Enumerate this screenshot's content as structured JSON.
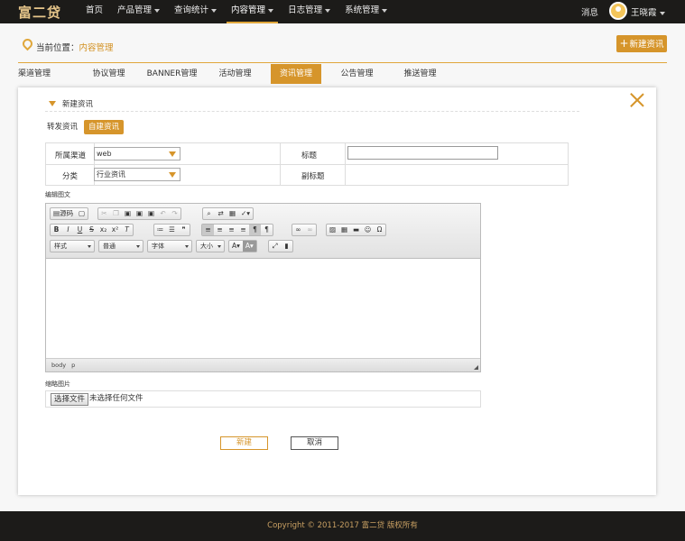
{
  "colors": {
    "accent": "#d6952b",
    "topbar": "#1c1b19"
  },
  "header": {
    "logo": "富二贷",
    "nav": [
      {
        "label": "首页",
        "dropdown": false
      },
      {
        "label": "产品管理",
        "dropdown": true
      },
      {
        "label": "查询统计",
        "dropdown": true
      },
      {
        "label": "内容管理",
        "dropdown": true,
        "active": true
      },
      {
        "label": "日志管理",
        "dropdown": true
      },
      {
        "label": "系统管理",
        "dropdown": true
      }
    ],
    "messages": "消息",
    "user": "王晓霞"
  },
  "breadcrumb": {
    "prefix": "当前位置：",
    "current": "内容管理"
  },
  "new_button": "新建资讯",
  "tabs": [
    "渠道管理",
    "协议管理",
    "BANNER管理",
    "活动管理",
    "资讯管理",
    "公告管理",
    "推送管理"
  ],
  "active_tab": "资讯管理",
  "dialog": {
    "title": "新建资讯",
    "sub_tabs": {
      "forward": "转发资讯",
      "create": "自建资讯"
    },
    "form": {
      "channel_label": "所属渠道",
      "channel_value": "web",
      "category_label": "分类",
      "category_value": "行业资讯",
      "title_label": "标题",
      "subtitle_label": "副标题"
    },
    "editor_label": "编辑图文",
    "editor": {
      "source": "源码",
      "combos": [
        "样式",
        "普通",
        "字体",
        "大小"
      ],
      "path": [
        "body",
        "p"
      ]
    },
    "thumbnail_label": "缩略图片",
    "file": {
      "button": "选择文件",
      "text": "未选择任何文件"
    },
    "submit": "新建",
    "cancel": "取消"
  },
  "footer": "Copyright © 2011-2017 富二贷 版权所有"
}
